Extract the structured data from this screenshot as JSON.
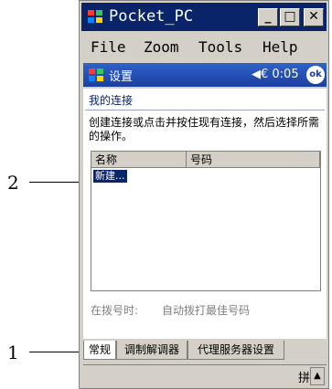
{
  "callouts": [
    {
      "number": "2"
    },
    {
      "number": "1"
    }
  ],
  "window": {
    "title": "Pocket_PC",
    "controls": {
      "minimize": "_",
      "maximize": "□",
      "close": "✕"
    }
  },
  "menubar": {
    "items": [
      "File",
      "Zoom",
      "Tools",
      "Help"
    ]
  },
  "navbar": {
    "title": "设置",
    "time": "◀€ 0:05",
    "ok_label": "ok"
  },
  "content": {
    "section_title": "我的连接",
    "instructions": "创建连接或点击并按住现有连接，然后选择所需的操作。",
    "list": {
      "columns": [
        "名称",
        "号码"
      ],
      "rows": [
        {
          "name": "新建..."
        }
      ]
    },
    "dial_label": "在拨号时:",
    "dial_value": "自动拨打最佳号码"
  },
  "tabs": [
    "常规",
    "调制解调器",
    "代理服务器设置"
  ],
  "statusbar": {
    "ime": "拼",
    "arrow": "▲"
  }
}
